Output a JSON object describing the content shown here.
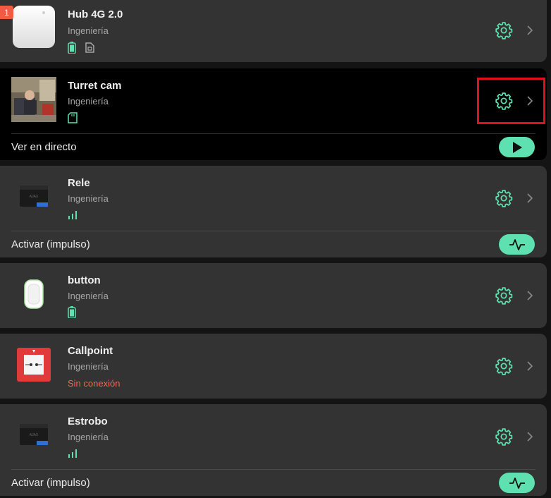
{
  "accent_color": "#5fe0b0",
  "offline_color": "#f26a4f",
  "devices": [
    {
      "name": "Hub 4G 2.0",
      "room": "Ingeniería",
      "badge": "1",
      "status_icons": [
        "battery-icon",
        "sim-card-icon"
      ]
    },
    {
      "name": "Turret cam",
      "room": "Ingeniería",
      "status_icons": [
        "sd-card-icon"
      ],
      "action_label": "Ver en directo",
      "action_icon": "play-icon"
    },
    {
      "name": "Rele",
      "room": "Ingeniería",
      "status_icons": [
        "signal-strength-icon"
      ],
      "action_label": "Activar (impulso)",
      "action_icon": "pulse-icon"
    },
    {
      "name": "button",
      "room": "Ingeniería",
      "status_icons": [
        "battery-icon"
      ]
    },
    {
      "name": "Callpoint",
      "room": "Ingeniería",
      "status_text": "Sin conexión"
    },
    {
      "name": "Estrobo",
      "room": "Ingeniería",
      "status_icons": [
        "signal-strength-icon"
      ],
      "action_label": "Activar (impulso)",
      "action_icon": "pulse-icon"
    }
  ]
}
